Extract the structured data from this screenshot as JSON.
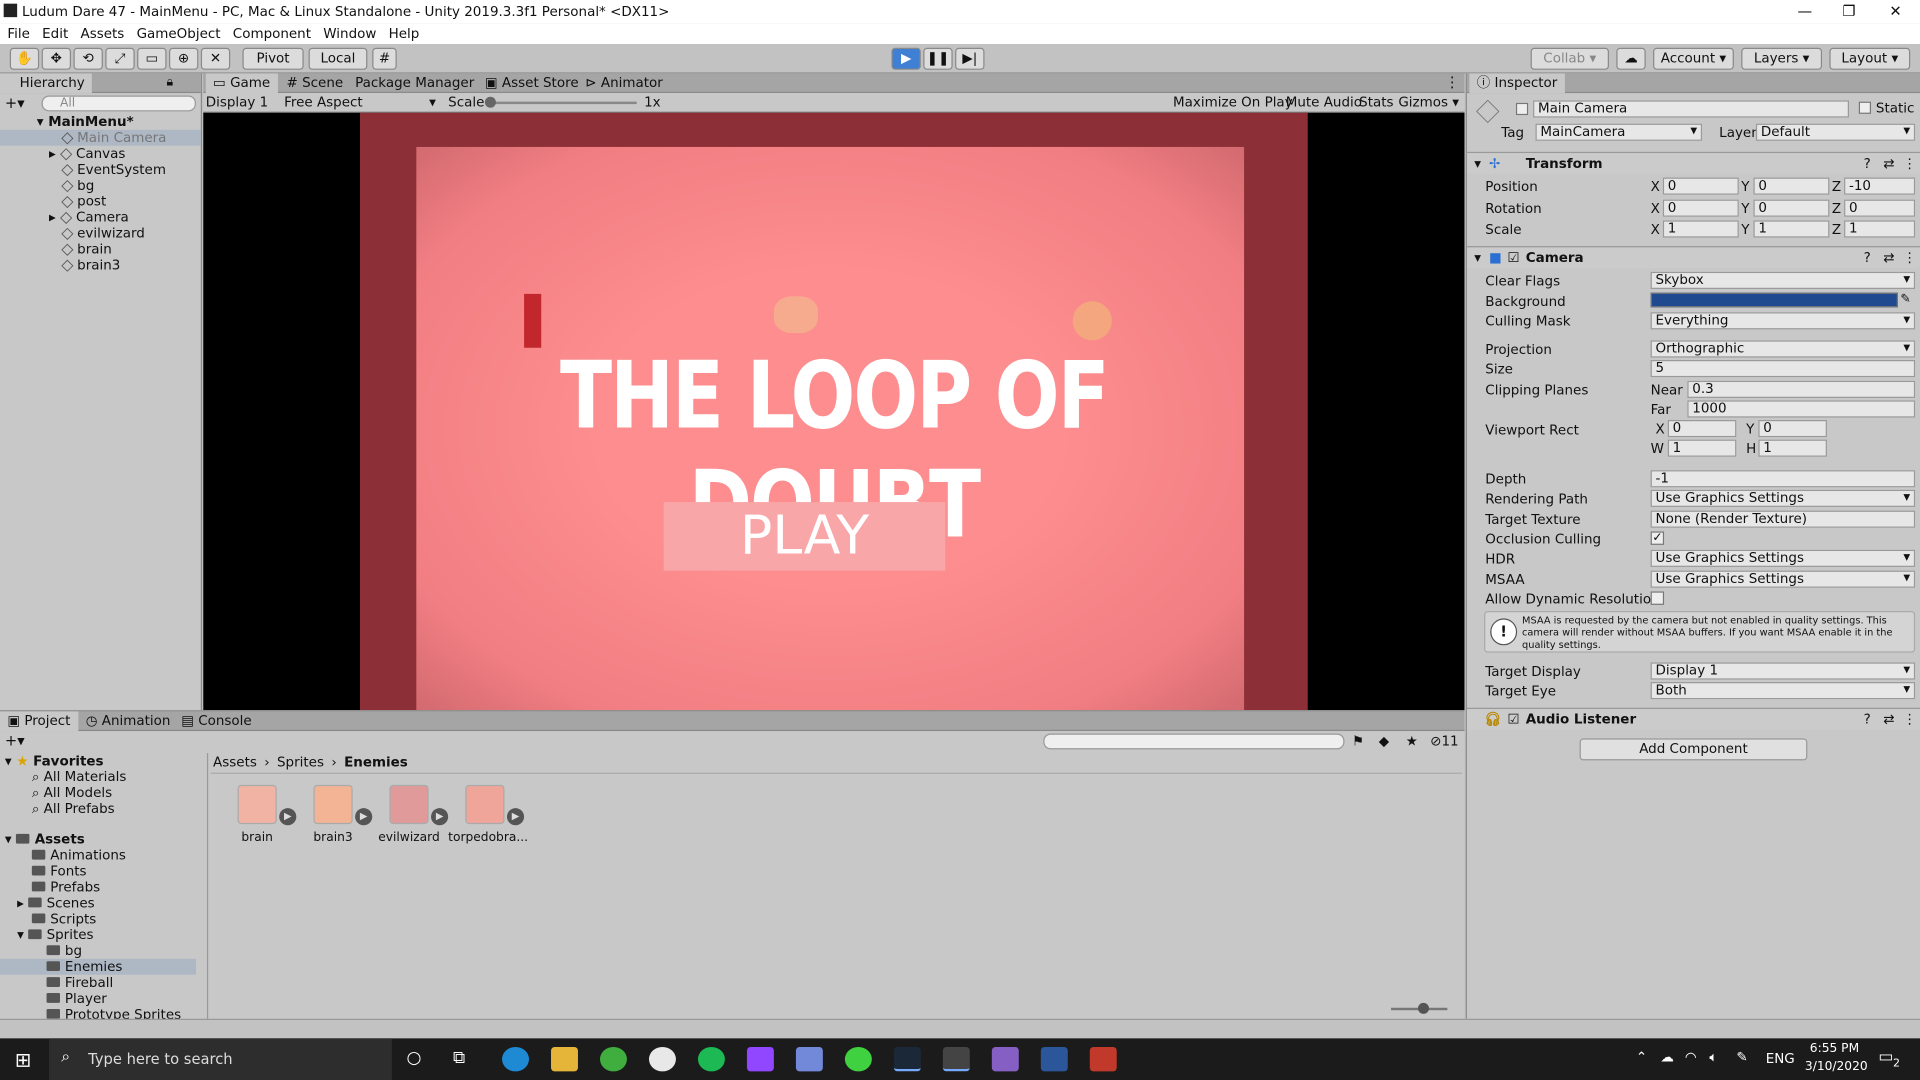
{
  "window": {
    "title": "Ludum Dare 47 - MainMenu - PC, Mac & Linux Standalone - Unity 2019.3.3f1 Personal* <DX11>"
  },
  "menu": [
    "File",
    "Edit",
    "Assets",
    "GameObject",
    "Component",
    "Window",
    "Help"
  ],
  "toolbar": {
    "pivot": "Pivot",
    "local": "Local",
    "collab": "Collab",
    "account": "Account",
    "layers": "Layers",
    "layout": "Layout"
  },
  "hierarchy": {
    "tab": "Hierarchy",
    "search_placeholder": "All",
    "scene": "MainMenu*",
    "items": [
      "Main Camera",
      "Canvas",
      "EventSystem",
      "bg",
      "post",
      "Camera",
      "evilwizard",
      "brain",
      "brain3"
    ]
  },
  "views": {
    "tabs": [
      "Game",
      "Scene",
      "Package Manager",
      "Asset Store",
      "Animator"
    ]
  },
  "gamebar": {
    "display": "Display 1",
    "aspect": "Free Aspect",
    "scale_label": "Scale",
    "scale_value": "1x",
    "maximize": "Maximize On Play",
    "mute": "Mute Audio",
    "stats": "Stats",
    "gizmos": "Gizmos"
  },
  "game": {
    "title": "THE LOOP OF DOUBT",
    "play": "PLAY"
  },
  "inspector": {
    "tab": "Inspector",
    "object_name": "Main Camera",
    "static": "Static",
    "tag_label": "Tag",
    "tag": "MainCamera",
    "layer_label": "Layer",
    "layer": "Default",
    "transform": {
      "title": "Transform",
      "position_label": "Position",
      "px": "0",
      "py": "0",
      "pz": "-10",
      "rotation_label": "Rotation",
      "rx": "0",
      "ry": "0",
      "rz": "0",
      "scale_label": "Scale",
      "sx": "1",
      "sy": "1",
      "sz": "1"
    },
    "camera": {
      "title": "Camera",
      "clear_flags_label": "Clear Flags",
      "clear_flags": "Skybox",
      "background_label": "Background",
      "background_color": "#1f4a8f",
      "culling_label": "Culling Mask",
      "culling": "Everything",
      "projection_label": "Projection",
      "projection": "Orthographic",
      "size_label": "Size",
      "size": "5",
      "clipping_label": "Clipping Planes",
      "near_label": "Near",
      "near": "0.3",
      "far_label": "Far",
      "far": "1000",
      "viewport_label": "Viewport Rect",
      "vx": "0",
      "vy": "0",
      "vw": "1",
      "vh": "1",
      "depth_label": "Depth",
      "depth": "-1",
      "rendering_label": "Rendering Path",
      "rendering": "Use Graphics Settings",
      "target_texture_label": "Target Texture",
      "target_texture": "None (Render Texture)",
      "occlusion_label": "Occlusion Culling",
      "hdr_label": "HDR",
      "hdr": "Use Graphics Settings",
      "msaa_label": "MSAA",
      "msaa": "Use Graphics Settings",
      "dynres_label": "Allow Dynamic Resolution",
      "warning": "MSAA is requested by the camera but not enabled in quality settings. This camera will render without MSAA buffers. If you want MSAA enable it in the quality settings.",
      "target_display_label": "Target Display",
      "target_display": "Display 1",
      "target_eye_label": "Target Eye",
      "target_eye": "Both"
    },
    "audio_listener": "Audio Listener",
    "add_component": "Add Component"
  },
  "project": {
    "tabs": [
      "Project",
      "Animation",
      "Console"
    ],
    "count": "11",
    "favorites_label": "Favorites",
    "favorites": [
      "All Materials",
      "All Models",
      "All Prefabs"
    ],
    "assets_label": "Assets",
    "folders": [
      "Animations",
      "Fonts",
      "Prefabs",
      "Scenes",
      "Scripts",
      "Sprites"
    ],
    "sprite_folders": [
      "bg",
      "Enemies",
      "Fireball",
      "Player",
      "Prototype Sprites"
    ],
    "breadcrumb": [
      "Assets",
      "Sprites",
      "Enemies"
    ],
    "assets": [
      "brain",
      "brain3",
      "evilwizard",
      "torpedobra..."
    ]
  },
  "taskbar": {
    "search": "Type here to search",
    "lang": "ENG",
    "time": "6:55 PM",
    "date": "3/10/2020",
    "notif": "2"
  }
}
